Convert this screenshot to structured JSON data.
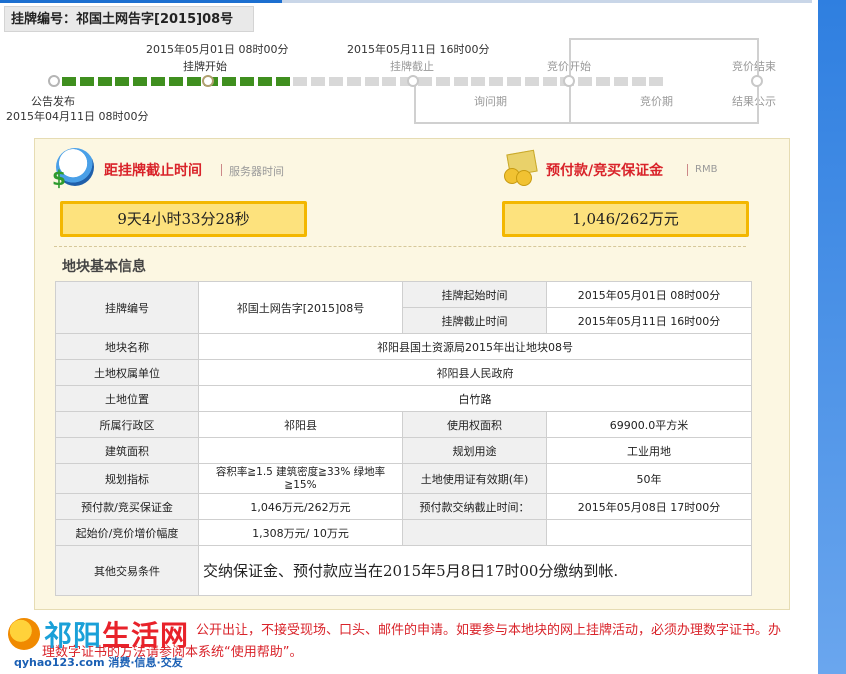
{
  "title": "挂牌编号：祁国土网告字[2015]08号",
  "timeline": {
    "announce_label": "公告发布",
    "announce_time": "2015年04月11日 08时00分",
    "listing_start_time": "2015年05月01日 08时00分",
    "listing_start_label": "挂牌开始",
    "listing_end_time": "2015年05月11日 16时00分",
    "listing_end_label": "挂牌截止",
    "bid_start_label": "竞价开始",
    "bid_end_label": "竞价结束",
    "inquiry_period_label": "询问期",
    "bid_period_label": "竞价期",
    "result_label": "结果公示",
    "progress_filled_segments": 13,
    "progress_total_segments": 34
  },
  "countdown": {
    "heading": "距挂牌截止时间",
    "sub": "服务器时间",
    "value": "9天4小时33分28秒"
  },
  "deposit": {
    "heading": "预付款/竞买保证金",
    "sub": "RMB",
    "value": "1,046/262万元"
  },
  "info": {
    "heading": "地块基本信息",
    "rows": {
      "listing_no_label": "挂牌编号",
      "listing_no_value": "祁国土网告字[2015]08号",
      "start_time_label": "挂牌起始时间",
      "start_time_value": "2015年05月01日 08时00分",
      "end_time_label": "挂牌截止时间",
      "end_time_value": "2015年05月11日 16时00分",
      "plot_name_label": "地块名称",
      "plot_name_value": "祁阳县国土资源局2015年出让地块08号",
      "owner_label": "土地权属单位",
      "owner_value": "祁阳县人民政府",
      "location_label": "土地位置",
      "location_value": "白竹路",
      "district_label": "所属行政区",
      "district_value": "祁阳县",
      "use_area_label": "使用权面积",
      "use_area_value": "69900.0平方米",
      "build_area_label": "建筑面积",
      "build_area_value": "",
      "plan_use_label": "规划用途",
      "plan_use_value": "工业用地",
      "plan_index_label": "规划指标",
      "plan_index_value": "容积率≧1.5 建筑密度≧33% 绿地率≧15%",
      "cert_period_label": "土地使用证有效期(年)",
      "cert_period_value": "50年",
      "deposit_label": "预付款/竞买保证金",
      "deposit_value": "1,046万元/262万元",
      "deposit_deadline_label": "预付款交纳截止时间：",
      "deposit_deadline_value": "2015年05月08日 17时00分",
      "start_price_label": "起始价/竞价增价幅度",
      "start_price_value": "1,308万元/ 10万元",
      "other_label": "其他交易条件",
      "other_value": "交纳保证金、预付款应当在2015年5月8日17时00分缴纳到帐."
    }
  },
  "notice_line1": "公开出让，不接受现场、口头、邮件的申请。如要参与本地块的网上挂牌活动，必须办理数字证书。办",
  "notice_line2": "理数字证书的方法请参阅本系统“使用帮助”。",
  "watermark": {
    "brand_a": "祁阳",
    "brand_b": "生活网",
    "url": "qyhao123.com 消费·信息·交友"
  }
}
